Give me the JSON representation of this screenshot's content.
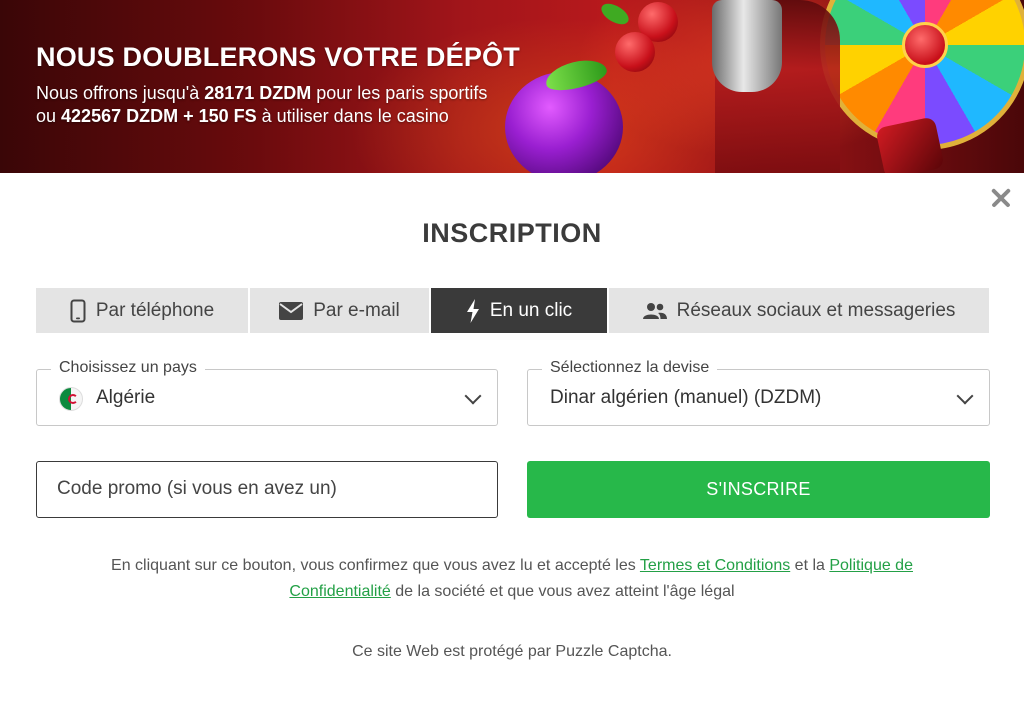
{
  "banner": {
    "title": "NOUS DOUBLERONS VOTRE DÉPÔT",
    "line1_prefix": "Nous offrons jusqu'à ",
    "line1_amount": "28171 DZDM",
    "line1_suffix": " pour les paris sportifs",
    "line2_prefix": "ou ",
    "line2_amount": "422567 DZDM + 150 FS",
    "line2_suffix": " à utiliser dans le casino"
  },
  "modal": {
    "title": "INSCRIPTION",
    "close_icon": "close-icon"
  },
  "tabs": [
    {
      "label": "Par téléphone",
      "icon": "phone-icon",
      "active": false
    },
    {
      "label": "Par e-mail",
      "icon": "envelope-icon",
      "active": false
    },
    {
      "label": "En un clic",
      "icon": "lightning-icon",
      "active": true
    },
    {
      "label": "Réseaux sociaux et messageries",
      "icon": "users-icon",
      "active": false
    }
  ],
  "country": {
    "label": "Choisissez un pays",
    "value": "Algérie",
    "flag_icon": "algeria-flag-icon"
  },
  "currency": {
    "label": "Sélectionnez la devise",
    "value": "Dinar algérien (manuel) (DZDM)"
  },
  "promo": {
    "placeholder": "Code promo (si vous en avez un)",
    "value": ""
  },
  "submit": {
    "label": "S'INSCRIRE"
  },
  "legal": {
    "part1": "En cliquant sur ce bouton, vous confirmez que vous avez lu et accepté les ",
    "terms_link": "Termes et Conditions",
    "part2": " et la ",
    "privacy_link": "Politique de Confidentialité",
    "part3": " de la société et que vous avez atteint l'âge légal"
  },
  "captcha_text": "Ce site Web est protégé par Puzzle Captcha.",
  "colors": {
    "accent_green": "#27b84a",
    "link_green": "#23a046",
    "active_tab": "#3a3a3a",
    "tab_bg": "#e4e4e4",
    "banner_red": "#a1151a"
  }
}
